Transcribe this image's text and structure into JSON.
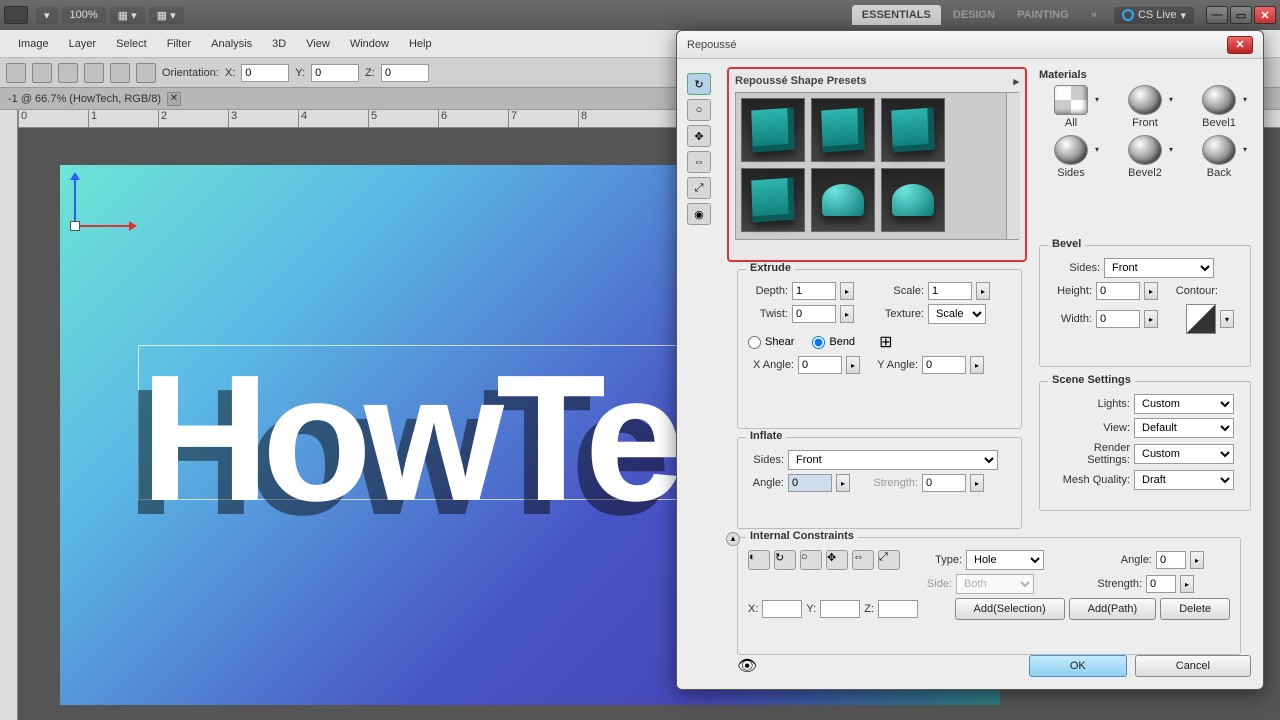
{
  "topbar": {
    "zoom": "100%",
    "workspaces": [
      "ESSENTIALS",
      "DESIGN",
      "PAINTING"
    ],
    "cslive": "CS Live"
  },
  "menu": [
    "Image",
    "Layer",
    "Select",
    "Filter",
    "Analysis",
    "3D",
    "View",
    "Window",
    "Help"
  ],
  "opt": {
    "label": "Orientation:",
    "xl": "X:",
    "x": "0",
    "yl": "Y:",
    "y": "0",
    "zl": "Z:",
    "z": "0"
  },
  "docTab": "-1 @ 66.7% (HowTech, RGB/8)",
  "ruler": [
    "0",
    "1",
    "2",
    "3",
    "4",
    "5",
    "6",
    "7",
    "8"
  ],
  "bigText": "HowTe",
  "dialog": {
    "title": "Repoussé",
    "presets": "Repoussé Shape Presets",
    "materials": {
      "title": "Materials",
      "items": [
        "All",
        "Front",
        "Bevel1",
        "Sides",
        "Bevel2",
        "Back"
      ]
    },
    "extrude": {
      "title": "Extrude",
      "depth_l": "Depth:",
      "depth": "1",
      "scale_l": "Scale:",
      "scale": "1",
      "twist_l": "Twist:",
      "twist": "0",
      "texture_l": "Texture:",
      "texture": "Scale",
      "shear": "Shear",
      "bend": "Bend",
      "xa_l": "X Angle:",
      "xa": "0",
      "ya_l": "Y Angle:",
      "ya": "0"
    },
    "inflate": {
      "title": "Inflate",
      "sides_l": "Sides:",
      "sides": "Front",
      "angle_l": "Angle:",
      "angle": "0",
      "strength_l": "Strength:",
      "strength": "0"
    },
    "bevel": {
      "title": "Bevel",
      "sides_l": "Sides:",
      "sides": "Front",
      "height_l": "Height:",
      "height": "0",
      "width_l": "Width:",
      "width": "0",
      "contour_l": "Contour:"
    },
    "scene": {
      "title": "Scene Settings",
      "lights_l": "Lights:",
      "lights": "Custom",
      "view_l": "View:",
      "view": "Default",
      "render_l": "Render Settings:",
      "render": "Custom",
      "mesh_l": "Mesh Quality:",
      "mesh": "Draft"
    },
    "intc": {
      "title": "Internal Constraints",
      "type_l": "Type:",
      "type": "Hole",
      "side_l": "Side:",
      "side": "Both",
      "angle_l": "Angle:",
      "angle": "0",
      "strength_l": "Strength:",
      "strength": "0",
      "xl": "X:",
      "yl": "Y:",
      "zl": "Z:",
      "addsel": "Add(Selection)",
      "addpath": "Add(Path)",
      "delete": "Delete"
    },
    "ok": "OK",
    "cancel": "Cancel"
  }
}
